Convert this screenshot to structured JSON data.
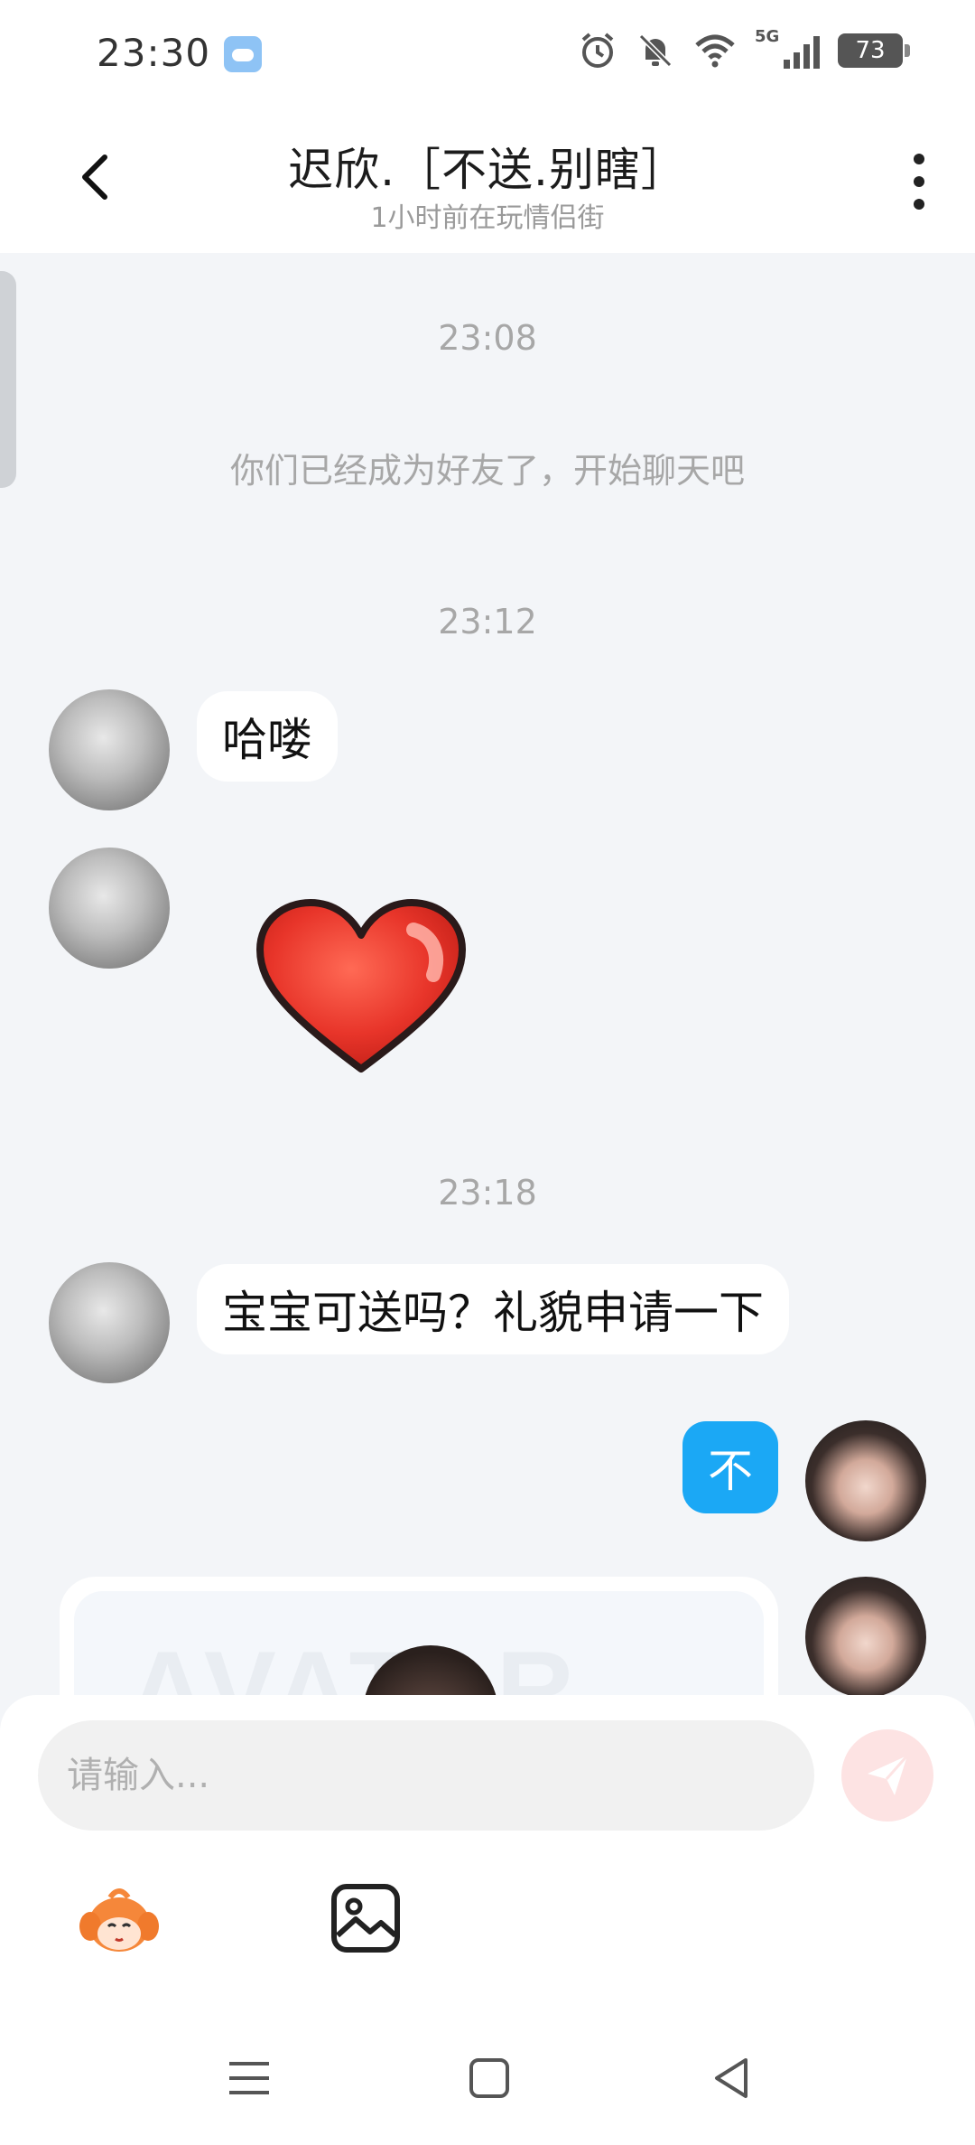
{
  "status_bar": {
    "time": "23:30",
    "battery_level": "73",
    "network": "5G",
    "icons": [
      "weather-icon",
      "alarm-icon",
      "mute-icon",
      "wifi-icon",
      "signal-icon",
      "battery-icon"
    ]
  },
  "header": {
    "title": "迟欣.［不送.别瞎］",
    "subtitle": "1小时前在玩情侣街"
  },
  "chat": {
    "timestamps": [
      "23:08",
      "23:12",
      "23:18"
    ],
    "system_message": "你们已经成为好友了，开始聊天吧",
    "messages": [
      {
        "from": "other",
        "type": "text",
        "text": "哈喽"
      },
      {
        "from": "other",
        "type": "sticker",
        "sticker": "heart-sticker"
      },
      {
        "from": "other",
        "type": "text",
        "text": "宝宝可送吗？礼貌申请一下"
      },
      {
        "from": "me",
        "type": "text",
        "text": "不"
      },
      {
        "from": "me",
        "type": "card",
        "watermark": "AVATAR"
      }
    ]
  },
  "input": {
    "placeholder": "请输入..."
  },
  "colors": {
    "accent_blue": "#1ba8f5",
    "background": "#f3f5f8",
    "send_button": "#fde3e3"
  }
}
